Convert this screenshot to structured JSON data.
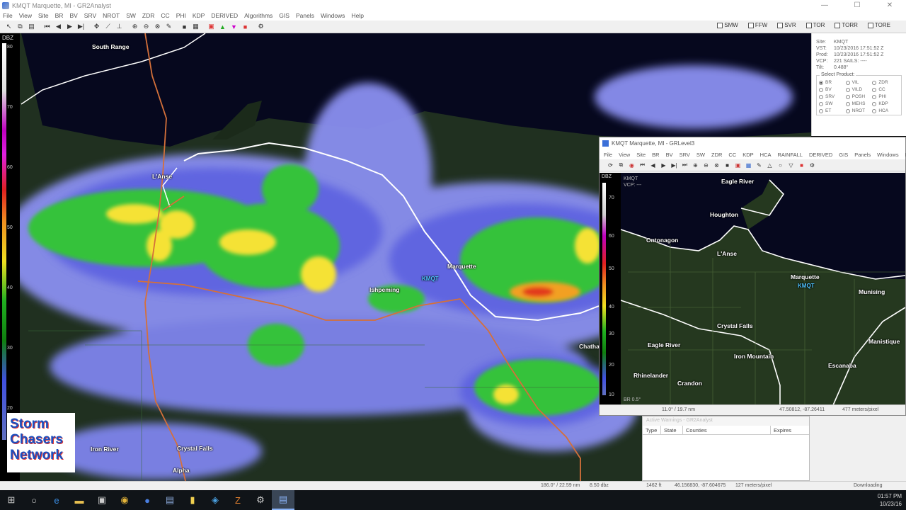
{
  "window": {
    "title": "KMQT Marquette, MI - GR2Analyst"
  },
  "menu": [
    "File",
    "View",
    "Site",
    "BR",
    "BV",
    "SRV",
    "NROT",
    "SW",
    "ZDR",
    "CC",
    "PHI",
    "KDP",
    "DERIVED",
    "Algorithms",
    "GIS",
    "Panels",
    "Windows",
    "Help"
  ],
  "warning_toggles": [
    "SMW",
    "FFW",
    "SVR",
    "TOR",
    "TORR",
    "TORE"
  ],
  "main_scale": {
    "unit": "DBZ",
    "ticks": [
      "80",
      "70",
      "60",
      "50",
      "40",
      "30",
      "20",
      "10"
    ]
  },
  "main_map_labels": [
    {
      "name": "South Range",
      "kind": "city"
    },
    {
      "name": "L'Anse",
      "kind": "city"
    },
    {
      "name": "Marquette",
      "kind": "city"
    },
    {
      "name": "KMQT",
      "kind": "radar"
    },
    {
      "name": "Ishpeming",
      "kind": "city"
    },
    {
      "name": "Iron River",
      "kind": "city"
    },
    {
      "name": "Crystal Falls",
      "kind": "city"
    },
    {
      "name": "Alpha",
      "kind": "city"
    },
    {
      "name": "Chatham",
      "kind": "city"
    }
  ],
  "logo": [
    "Storm",
    "Chasers",
    "Network"
  ],
  "info_panel": {
    "rows": [
      {
        "k": "Site:",
        "v": "KMQT"
      },
      {
        "k": "VST:",
        "v": "10/23/2016 17:51:52 Z"
      },
      {
        "k": "Prod:",
        "v": "10/23/2016 17:51:52 Z"
      },
      {
        "k": "VCP:",
        "v": "221      SAILS: ----"
      },
      {
        "k": "Tilt:",
        "v": "0.488°"
      }
    ],
    "select_label": "Select Product:",
    "products": [
      {
        "label": "BR",
        "selected": true
      },
      {
        "label": "VIL",
        "selected": false
      },
      {
        "label": "ZDR",
        "selected": false
      },
      {
        "label": "BV",
        "selected": false
      },
      {
        "label": "VILD",
        "selected": false
      },
      {
        "label": "CC",
        "selected": false
      },
      {
        "label": "SRV",
        "selected": false
      },
      {
        "label": "POSH",
        "selected": false
      },
      {
        "label": "PHI",
        "selected": false
      },
      {
        "label": "SW",
        "selected": false
      },
      {
        "label": "MEHS",
        "selected": false
      },
      {
        "label": "KDP",
        "selected": false
      },
      {
        "label": "ET",
        "selected": false
      },
      {
        "label": "NROT",
        "selected": false
      },
      {
        "label": "HCA",
        "selected": false
      }
    ]
  },
  "window2": {
    "title": "KMQT Marquette, MI - GRLevel3",
    "menu": [
      "File",
      "View",
      "Site",
      "BR",
      "BV",
      "SRV",
      "SW",
      "ZDR",
      "CC",
      "KDP",
      "HCA",
      "RAINFALL",
      "DERIVED",
      "GIS",
      "Panels",
      "Windows",
      "H"
    ],
    "site": "KMQT",
    "vcp": "VCP:  ---",
    "scale_unit": "DBZ",
    "scale_ticks": [
      "70",
      "60",
      "50",
      "40",
      "30",
      "20",
      "10"
    ],
    "product": "BR  0.5°",
    "status_left": "11.0° / 19.7 nm",
    "status_mid": "47.50812, -87.26411",
    "status_right": "477 meters/pixel",
    "labels": [
      "Eagle River",
      "Houghton",
      "Ontonagon",
      "L'Anse",
      "Marquette",
      "KMQT",
      "Munising",
      "Crystal Falls",
      "Eagle River",
      "Iron Mountain",
      "Manistique",
      "Rhinelander",
      "Crandon",
      "Escanaba"
    ]
  },
  "warnings_panel": {
    "title": "Active Warnings - GR2Analyst",
    "columns": [
      "Type",
      "State",
      "Counties",
      "Expires"
    ]
  },
  "statusbar": {
    "pos": "186.0° / 22.59 nm",
    "val": "8.50 dbz",
    "alt": "1462 ft",
    "coords": "46.156830, -87.604675",
    "scale": "127 meters/pixel",
    "state": "Downloading"
  },
  "clock": {
    "time": "01:57 PM",
    "date": "10/23/16"
  },
  "colors": {
    "radar_light": "#8a8ff0",
    "radar_mid": "#5a5fe0",
    "radar_green": "#34c23a",
    "radar_yellow": "#f5e235",
    "radar_red": "#e23a1f",
    "road": "#d4703a",
    "border": "#ffffff"
  }
}
